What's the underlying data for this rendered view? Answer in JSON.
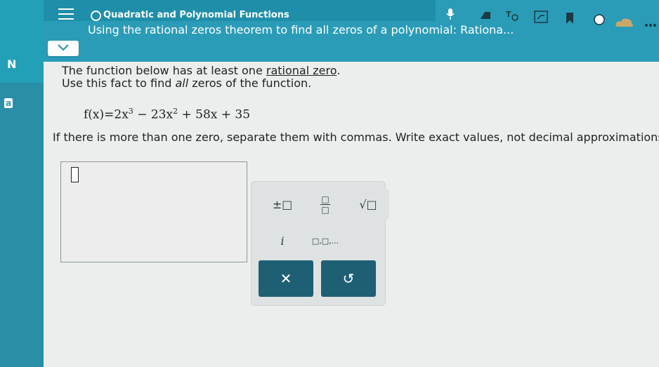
{
  "header": {
    "section_title": "Quadratic and Polynomial Functions",
    "title": "Using the rational zeros theorem to find all zeros of a polynomial: Rationa...",
    "left_letter_1": "N",
    "left_letter_2": "a"
  },
  "problem": {
    "intro_line1_prefix": "The function below has at least one ",
    "intro_line1_link": "rational zero",
    "intro_line1_suffix": ".",
    "intro_line2_prefix": "Use this fact to find ",
    "intro_line2_emph": "all",
    "intro_line2_suffix": " zeros of the function.",
    "formula": {
      "lhs": "f(x)=2x",
      "p1": "3",
      "mid1": " − 23x",
      "p2": "2",
      "tail": " + 58x + 35"
    },
    "instructions": "If there is more than one zero, separate them with commas. Write exact values, not decimal approximations."
  },
  "keypad": {
    "plus_minus": "±□",
    "fraction_top": "□",
    "fraction_bottom": "□",
    "sqrt": "√□",
    "imag": "i",
    "list": "□,□,...",
    "clear": "✕",
    "undo": "↺"
  },
  "icons": [
    "hamburger-icon",
    "chevron-down-icon",
    "mic-icon",
    "highlighter-icon",
    "tts-icon",
    "resize-icon",
    "bookmark-icon",
    "circle-icon",
    "cloud-icon",
    "more-icon"
  ]
}
